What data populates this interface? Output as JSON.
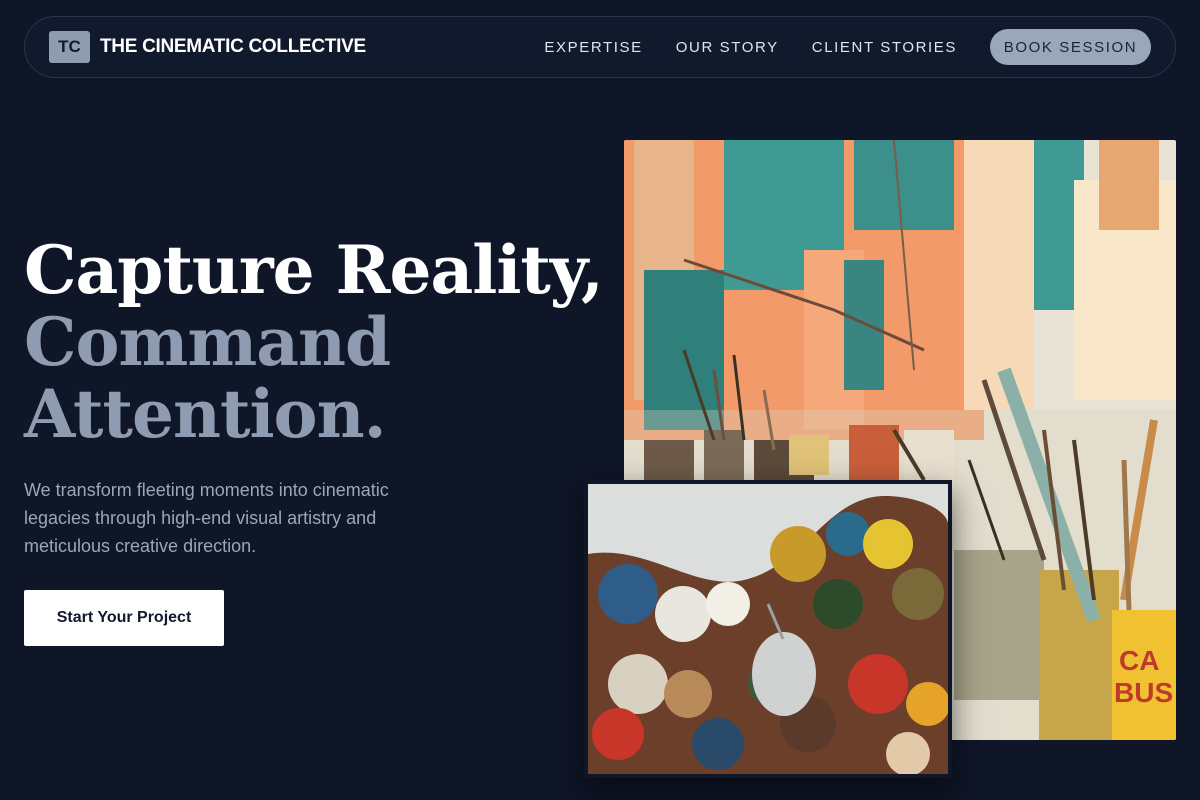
{
  "brand": {
    "logo_initials": "TC",
    "name": "THE CINEMATIC COLLECTIVE"
  },
  "nav": {
    "links": [
      {
        "label": "EXPERTISE"
      },
      {
        "label": "OUR STORY"
      },
      {
        "label": "CLIENT STORIES"
      }
    ],
    "cta_label": "BOOK SESSION"
  },
  "hero": {
    "headline_line1": "Capture Reality,",
    "headline_line2": "Command",
    "headline_line3": "Attention.",
    "description": "We transform fleeting moments into cinematic legacies through high-end visual artistry and meticulous creative direction.",
    "cta_label": "Start Your Project"
  },
  "colors": {
    "background": "#0f1628",
    "accent_muted": "#8e9bb0",
    "cta_background": "#ffffff"
  },
  "images": {
    "studio_icon": "art-studio-photo",
    "palette_icon": "paint-palette-photo"
  }
}
